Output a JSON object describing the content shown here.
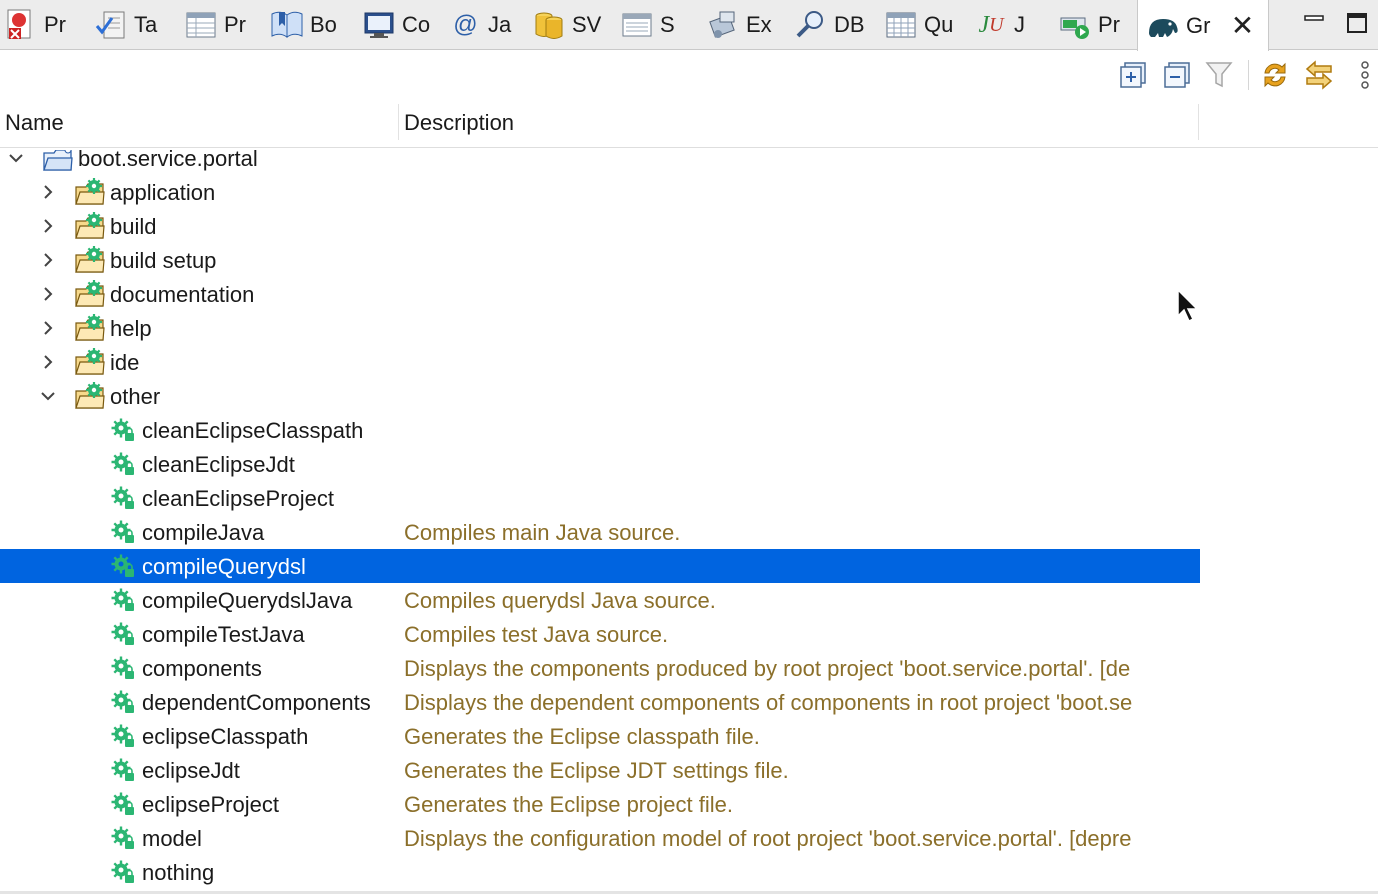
{
  "tabs": [
    {
      "label": "Pr",
      "icon": "project-explorer-icon"
    },
    {
      "label": "Ta",
      "icon": "tasks-icon"
    },
    {
      "label": "Pr",
      "icon": "properties-icon"
    },
    {
      "label": "Bo",
      "icon": "bookmarks-icon"
    },
    {
      "label": "Co",
      "icon": "console-icon"
    },
    {
      "label": "Ja",
      "icon": "javadoc-icon"
    },
    {
      "label": "SV",
      "icon": "svn-repositories-icon"
    },
    {
      "label": "S",
      "icon": "servers-icon"
    },
    {
      "label": "Ex",
      "icon": "executables-icon"
    },
    {
      "label": "DB",
      "icon": "db-search-icon"
    },
    {
      "label": "Qu",
      "icon": "query-table-icon"
    },
    {
      "label": "J",
      "icon": "junit-icon"
    },
    {
      "label": "Pr",
      "icon": "progress-icon"
    },
    {
      "label": "Gr",
      "icon": "gradle-elephant-icon",
      "active": true
    }
  ],
  "toolbar": {
    "expand_all": "expand-all-icon",
    "collapse_all": "collapse-all-icon",
    "filter": "filter-icon",
    "refresh": "refresh-tasks-icon",
    "link": "link-with-selection-icon",
    "more": "view-menu-icon"
  },
  "columns": {
    "name": "Name",
    "description": "Description"
  },
  "tree": {
    "root": {
      "label": "boot.service.portal",
      "expanded": true
    },
    "groups": [
      {
        "label": "application",
        "expanded": false
      },
      {
        "label": "build",
        "expanded": false
      },
      {
        "label": "build setup",
        "expanded": false
      },
      {
        "label": "documentation",
        "expanded": false
      },
      {
        "label": "help",
        "expanded": false
      },
      {
        "label": "ide",
        "expanded": false
      },
      {
        "label": "other",
        "expanded": true
      }
    ],
    "tasks": [
      {
        "name": "cleanEclipseClasspath",
        "description": ""
      },
      {
        "name": "cleanEclipseJdt",
        "description": ""
      },
      {
        "name": "cleanEclipseProject",
        "description": ""
      },
      {
        "name": "compileJava",
        "description": "Compiles main Java source."
      },
      {
        "name": "compileQuerydsl",
        "description": "",
        "selected": true
      },
      {
        "name": "compileQuerydslJava",
        "description": "Compiles querydsl Java source."
      },
      {
        "name": "compileTestJava",
        "description": "Compiles test Java source."
      },
      {
        "name": "components",
        "description": "Displays the components produced by root project 'boot.service.portal'. [de"
      },
      {
        "name": "dependentComponents",
        "description": "Displays the dependent components of components in root project 'boot.se"
      },
      {
        "name": "eclipseClasspath",
        "description": "Generates the Eclipse classpath file."
      },
      {
        "name": "eclipseJdt",
        "description": "Generates the Eclipse JDT settings file."
      },
      {
        "name": "eclipseProject",
        "description": "Generates the Eclipse project file."
      },
      {
        "name": "model",
        "description": "Displays the configuration model of root project 'boot.service.portal'. [depre"
      },
      {
        "name": "nothing",
        "description": ""
      }
    ]
  },
  "colors": {
    "selection": "#0064e0",
    "description_text": "#8b6f2a",
    "task_gear": "#2bb673"
  }
}
